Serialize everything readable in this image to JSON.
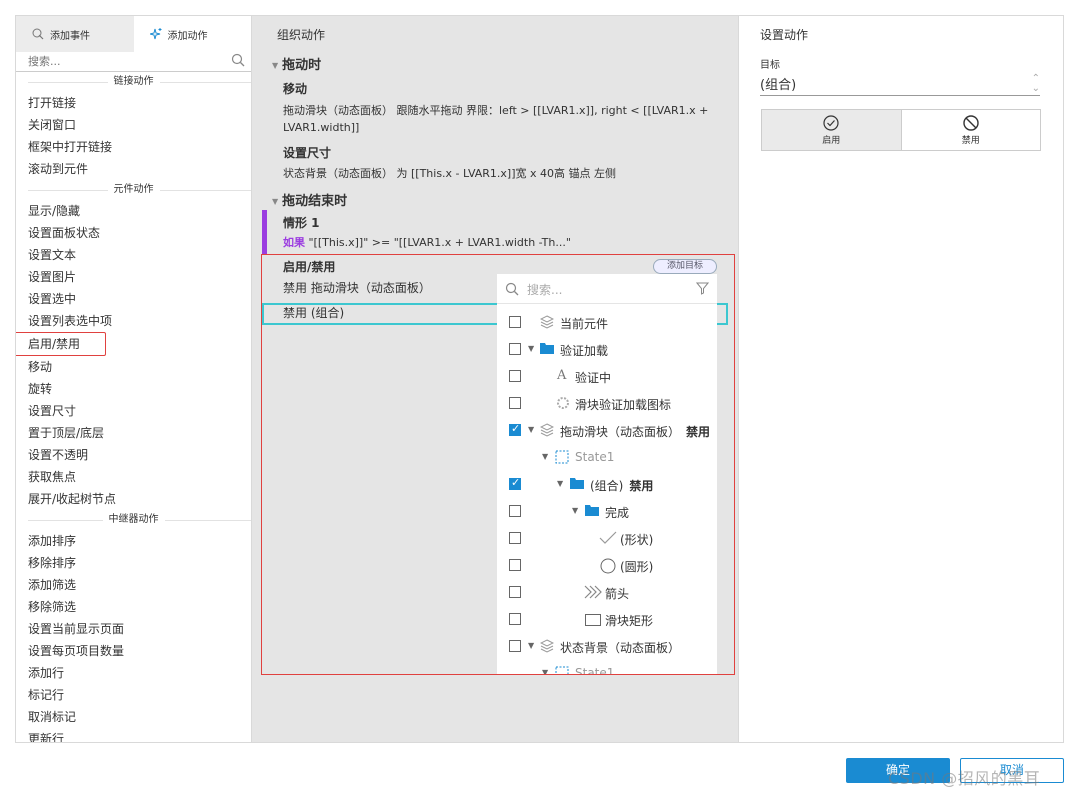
{
  "left": {
    "tabs": [
      {
        "label": "添加事件",
        "icon": "event-icon"
      },
      {
        "label": "添加动作",
        "icon": "sparkle-icon"
      }
    ],
    "search_placeholder": "搜索...",
    "groups": [
      {
        "title": "链接动作",
        "items": [
          "打开链接",
          "关闭窗口",
          "框架中打开链接",
          "滚动到元件"
        ]
      },
      {
        "title": "元件动作",
        "items": [
          "显示/隐藏",
          "设置面板状态",
          "设置文本",
          "设置图片",
          "设置选中",
          "设置列表选中项",
          "启用/禁用",
          "移动",
          "旋转",
          "设置尺寸",
          "置于顶层/底层",
          "设置不透明",
          "获取焦点",
          "展开/收起树节点"
        ]
      },
      {
        "title": "中继器动作",
        "items": [
          "添加排序",
          "移除排序",
          "添加筛选",
          "移除筛选",
          "设置当前显示页面",
          "设置每页项目数量",
          "添加行",
          "标记行",
          "取消标记",
          "更新行"
        ]
      }
    ]
  },
  "middle": {
    "title": "组织动作",
    "drag_section": "拖动时",
    "move_title": "移动",
    "move_desc_1": "拖动滑块（动态面板） 跟随水平拖动 界限：left > [[LVAR1.x]], right < [[LVAR1.x +",
    "move_desc_2": "LVAR1.width]]",
    "size_title": "设置尺寸",
    "size_desc": "状态背景（动态面板） 为 [[This.x - LVAR1.x]]宽 x 40高 锚点 左侧",
    "drag_end_section": "拖动结束时",
    "case_title": "情形 1",
    "case_if": "如果",
    "case_cond": " \"[[This.x]]\" >= \"[[LVAR1.x + LVAR1.width -Th...\"",
    "enable_title": "启用/禁用",
    "add_target": "添加目标",
    "action_1": "禁用 拖动滑块（动态面板）",
    "action_2": "禁用 (组合)"
  },
  "dropdown": {
    "search_placeholder": "搜索...",
    "rows": [
      {
        "label": "当前元件",
        "checked": false,
        "icon": "layers-icon"
      },
      {
        "label": "验证加载",
        "checked": false,
        "icon": "folder-icon"
      },
      {
        "label": "验证中",
        "checked": false,
        "icon": "text-icon"
      },
      {
        "label": "滑块验证加载图标",
        "checked": false,
        "icon": "spinner-icon"
      },
      {
        "label": "拖动滑块（动态面板）",
        "suffix": "禁用",
        "checked": true,
        "icon": "layers-icon"
      },
      {
        "label": "State1",
        "icon": "state-icon"
      },
      {
        "label": "(组合)",
        "suffix": "禁用",
        "checked": true,
        "icon": "folder-icon"
      },
      {
        "label": "完成",
        "checked": false,
        "icon": "folder-icon"
      },
      {
        "label": "(形状)",
        "checked": false,
        "icon": "check-shape-icon"
      },
      {
        "label": "(圆形)",
        "checked": false,
        "icon": "circle-icon"
      },
      {
        "label": "箭头",
        "checked": false,
        "icon": "arrows-icon"
      },
      {
        "label": "滑块矩形",
        "checked": false,
        "icon": "rect-icon"
      },
      {
        "label": "状态背景（动态面板）",
        "checked": false,
        "icon": "layers-icon"
      },
      {
        "label": "State1",
        "icon": "state-icon"
      }
    ]
  },
  "right": {
    "title": "设置动作",
    "target_label": "目标",
    "target_value": "(组合)",
    "enable_label": "启用",
    "disable_label": "禁用"
  },
  "buttons": {
    "ok": "确定",
    "cancel": "取消"
  },
  "watermark": "CSDN @招风的黑耳",
  "colors": {
    "primary": "#1a8bd2",
    "highlight_red": "#e0413f",
    "cyan": "#3cc7d0",
    "purple": "#9b3de0"
  }
}
